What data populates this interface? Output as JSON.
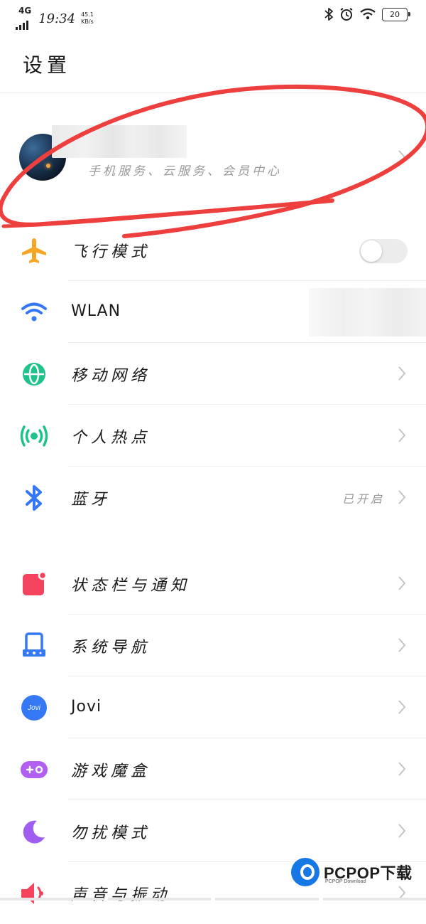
{
  "status_bar": {
    "network": "4G",
    "time": "19:34",
    "speed_value": "45.1",
    "speed_unit": "KB/s",
    "battery": "20",
    "icons": [
      "bluetooth-icon",
      "alarm-icon",
      "wifi-icon",
      "battery-icon"
    ]
  },
  "page_title": "设置",
  "account": {
    "subtitle": "手机服务、云服务、会员中心"
  },
  "settings_group_1": [
    {
      "label": "飞行模式",
      "icon": "airplane-icon",
      "color": "#f5a623",
      "control": "toggle",
      "toggle_on": false
    },
    {
      "label": "WLAN",
      "icon": "wifi-icon",
      "color": "#3478f6",
      "control": "none"
    },
    {
      "label": "移动网络",
      "icon": "globe-icon",
      "color": "#1fc28a",
      "control": "chevron"
    },
    {
      "label": "个人热点",
      "icon": "hotspot-icon",
      "color": "#1fc28a",
      "control": "chevron"
    },
    {
      "label": "蓝牙",
      "icon": "bluetooth-icon",
      "color": "#3478f6",
      "control": "chevron",
      "status": "已开启"
    }
  ],
  "settings_group_2": [
    {
      "label": "状态栏与通知",
      "icon": "notification-icon",
      "color": "#f4435c"
    },
    {
      "label": "系统导航",
      "icon": "navigation-icon",
      "color": "#3478f6"
    },
    {
      "label": "Jovi",
      "icon": "jovi-icon",
      "color": "#3478f6",
      "icon_text": "Jovi"
    },
    {
      "label": "游戏魔盒",
      "icon": "gamepad-icon",
      "color": "#b15ff0"
    },
    {
      "label": "勿扰模式",
      "icon": "moon-icon",
      "color": "#a05ef0"
    },
    {
      "label": "声音与振动",
      "icon": "speaker-icon",
      "color": "#f4435c"
    }
  ],
  "watermark": {
    "brand": "PCPOP下载",
    "sub": "PCPOP Download"
  }
}
